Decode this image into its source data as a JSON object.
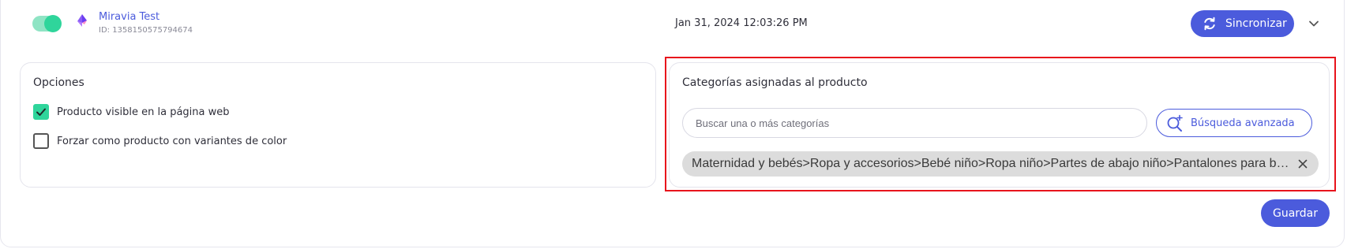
{
  "header": {
    "store_name": "Miravia Test",
    "store_id": "ID: 1358150575794674",
    "last_sync": "Jan 31, 2024 12:03:26 PM",
    "sync_label": "Sincronizar",
    "toggle_enabled": true,
    "accent_color": "#4b5bdc",
    "toggle_color": "#2fd59b"
  },
  "options": {
    "title": "Opciones",
    "items": [
      {
        "label": "Producto visible en la página web",
        "checked": true
      },
      {
        "label": "Forzar como producto con variantes de color",
        "checked": false
      }
    ]
  },
  "categories": {
    "title": "Categorías asignadas al producto",
    "search_placeholder": "Buscar una o más categorías",
    "advanced_search_label": "Búsqueda avanzada",
    "assigned": [
      "Maternidad y bebés>Ropa y accesorios>Bebé niño>Ropa niño>Partes de abajo niño>Pantalones para beb…"
    ],
    "highlight_color": "#e8141c"
  },
  "footer": {
    "save_label": "Guardar"
  }
}
